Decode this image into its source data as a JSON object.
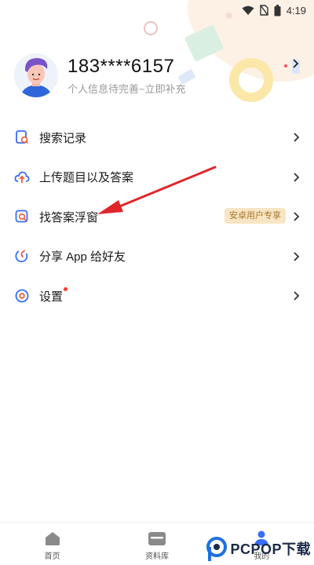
{
  "status_bar": {
    "time": "4:19"
  },
  "profile": {
    "phone": "183****6157",
    "subtitle": "个人信息待完善~立即补充"
  },
  "menu": [
    {
      "label": "搜索记录",
      "icon": "search-history-icon"
    },
    {
      "label": "上传题目以及答案",
      "icon": "upload-icon"
    },
    {
      "label": "找答案浮窗",
      "icon": "floating-window-icon",
      "badge": "安卓用户专享"
    },
    {
      "label": "分享 App 给好友",
      "icon": "share-icon"
    },
    {
      "label": "设置",
      "icon": "settings-icon",
      "dot": true
    }
  ],
  "bottom_nav": [
    {
      "label": "首页",
      "icon": "home-icon"
    },
    {
      "label": "资料库",
      "icon": "folder-icon"
    },
    {
      "label": "我的",
      "icon": "profile-icon",
      "active": true
    }
  ],
  "watermark": {
    "text": "PCPOP下载",
    "logo": "pcpop-logo"
  },
  "colors": {
    "accent": "#3b6ef5",
    "badge_bg": "#f8e5c3",
    "badge_text": "#a8762b",
    "arrow": "#e0262a",
    "dot": "#ff3b30"
  }
}
